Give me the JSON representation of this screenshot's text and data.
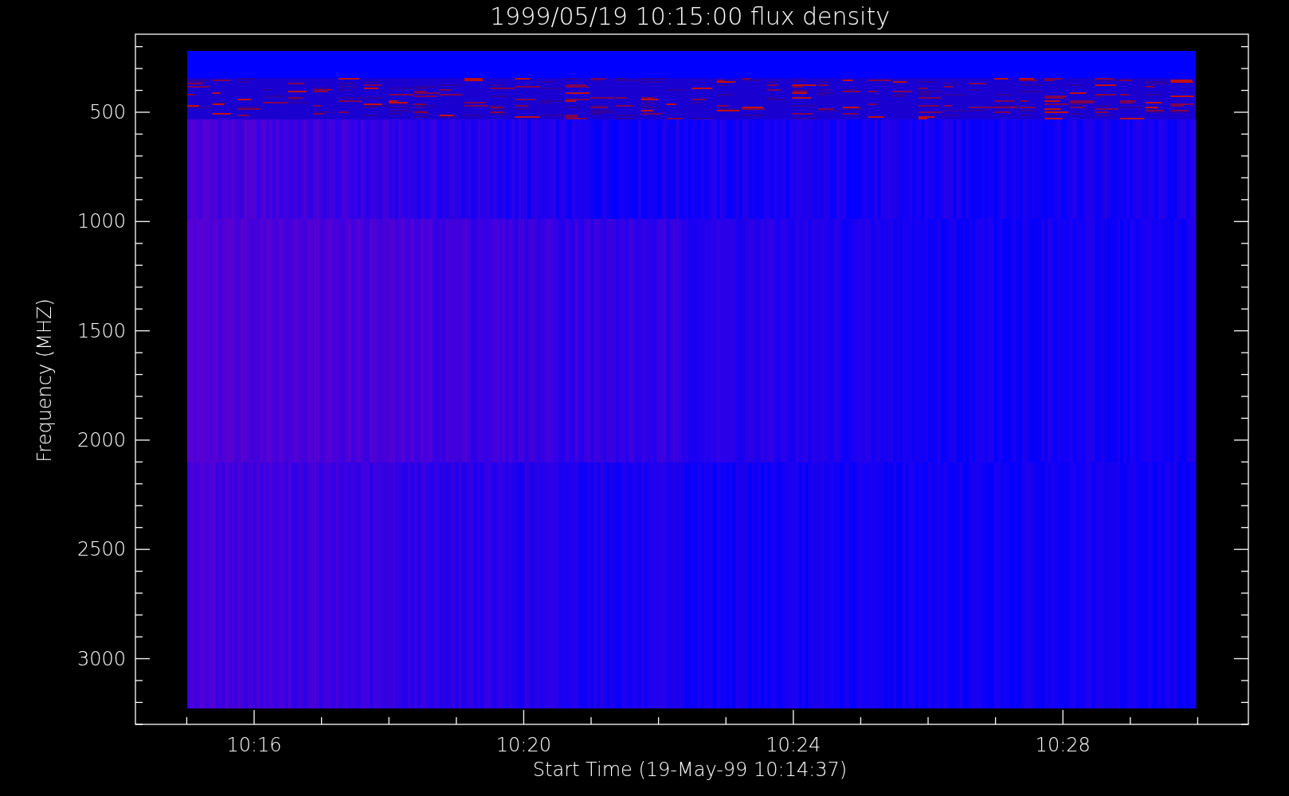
{
  "title": "1999/05/19 10:15:00 flux density",
  "y_axis": {
    "label": "Frequency (MHZ)",
    "ticks": [
      "500",
      "1000",
      "1500",
      "2000",
      "2500",
      "3000"
    ]
  },
  "x_axis": {
    "label": "Start Time (19-May-99 10:14:37)",
    "ticks": [
      "10:16",
      "10:20",
      "10:24",
      "10:28"
    ]
  }
}
